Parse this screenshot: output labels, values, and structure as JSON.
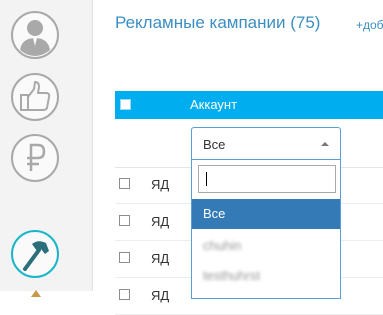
{
  "header": {
    "title": "Рекламные кампании (75)",
    "add_link": "+доб"
  },
  "table": {
    "column_account": "Аккаунт",
    "rows": [
      {
        "label": "ЯД"
      },
      {
        "label": "ЯД"
      },
      {
        "label": "ЯД"
      },
      {
        "label": "ЯД"
      }
    ]
  },
  "account_filter": {
    "selected_value": "Все",
    "search_value": "",
    "options": [
      "Все",
      "chuhin",
      "testhuhrst"
    ]
  },
  "sidebar": {
    "icons": [
      "user-icon",
      "thumbs-up-icon",
      "ruble-icon",
      "hammer-icon"
    ]
  },
  "colors": {
    "accent": "#00adef",
    "link": "#3b8ec2",
    "selected_option": "#337ab7",
    "icon_teal": "#1bb5c9"
  }
}
